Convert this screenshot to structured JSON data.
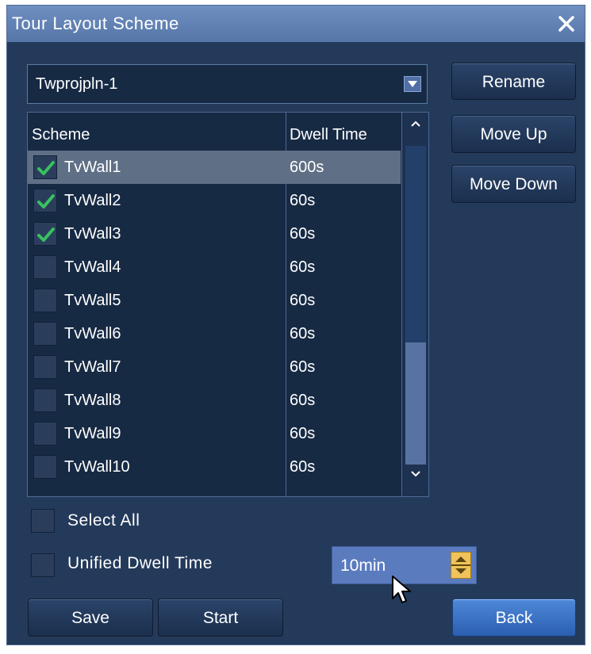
{
  "window": {
    "title": "Tour Layout Scheme",
    "close_icon": "close-icon"
  },
  "project_select": {
    "value": "Twprojpln-1"
  },
  "buttons": {
    "rename": "Rename",
    "move_up": "Move Up",
    "move_down": "Move Down",
    "save": "Save",
    "start": "Start",
    "back": "Back"
  },
  "table": {
    "headers": {
      "scheme": "Scheme",
      "dwell": "Dwell Time"
    },
    "rows": [
      {
        "name": "TvWall1",
        "dwell": "600s",
        "checked": true,
        "selected": true
      },
      {
        "name": "TvWall2",
        "dwell": "60s",
        "checked": true,
        "selected": false
      },
      {
        "name": "TvWall3",
        "dwell": "60s",
        "checked": true,
        "selected": false
      },
      {
        "name": "TvWall4",
        "dwell": "60s",
        "checked": false,
        "selected": false
      },
      {
        "name": "TvWall5",
        "dwell": "60s",
        "checked": false,
        "selected": false
      },
      {
        "name": "TvWall6",
        "dwell": "60s",
        "checked": false,
        "selected": false
      },
      {
        "name": "TvWall7",
        "dwell": "60s",
        "checked": false,
        "selected": false
      },
      {
        "name": "TvWall8",
        "dwell": "60s",
        "checked": false,
        "selected": false
      },
      {
        "name": "TvWall9",
        "dwell": "60s",
        "checked": false,
        "selected": false
      },
      {
        "name": "TvWall10",
        "dwell": "60s",
        "checked": false,
        "selected": false
      }
    ]
  },
  "options": {
    "select_all": {
      "label": "Select All",
      "checked": false
    },
    "unified_dwell": {
      "label": "Unified Dwell Time",
      "checked": false
    }
  },
  "dwell_spinner": {
    "value": "10min"
  },
  "colors": {
    "background": "#243a5a",
    "titlebar": "#5f80b5",
    "check": "#39c060",
    "back_button": "#3d75c6",
    "spinner": "#5b7bbf"
  }
}
